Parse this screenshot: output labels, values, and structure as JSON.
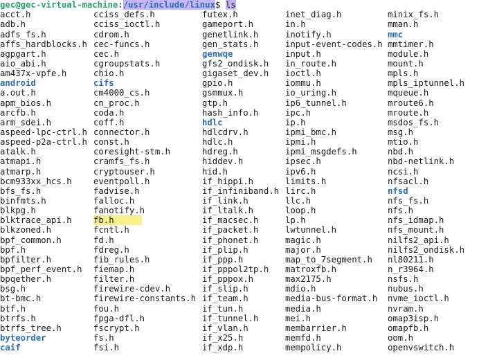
{
  "prompt": {
    "user_host": "gec@gec-virtual-machine",
    "separator": ":",
    "path": "/usr/include/linux",
    "dollar": "$ ",
    "command": "ls"
  },
  "colors": {
    "user": "#26a269",
    "directory": "#2a6fb7",
    "selection": "#c7b6f7",
    "highlight": "#f6f08a"
  },
  "columns": [
    [
      {
        "name": "acct.h"
      },
      {
        "name": "adb.h"
      },
      {
        "name": "adfs_fs.h"
      },
      {
        "name": "affs_hardblocks.h"
      },
      {
        "name": "agpgart.h"
      },
      {
        "name": "aio_abi.h"
      },
      {
        "name": "am437x-vpfe.h"
      },
      {
        "name": "android",
        "dir": true
      },
      {
        "name": "a.out.h"
      },
      {
        "name": "apm_bios.h"
      },
      {
        "name": "arcfb.h"
      },
      {
        "name": "arm_sdei.h"
      },
      {
        "name": "aspeed-lpc-ctrl.h"
      },
      {
        "name": "aspeed-p2a-ctrl.h"
      },
      {
        "name": "atalk.h"
      },
      {
        "name": "atmapi.h"
      },
      {
        "name": "atmarp.h"
      },
      {
        "name": "bcm933xx_hcs.h"
      },
      {
        "name": "bfs_fs.h"
      },
      {
        "name": "binfmts.h"
      },
      {
        "name": "blkpg.h"
      },
      {
        "name": "blktrace_api.h"
      },
      {
        "name": "blkzoned.h"
      },
      {
        "name": "bpf_common.h"
      },
      {
        "name": "bpf.h"
      },
      {
        "name": "bpfilter.h"
      },
      {
        "name": "bpf_perf_event.h"
      },
      {
        "name": "bpqether.h"
      },
      {
        "name": "bsg.h"
      },
      {
        "name": "bt-bmc.h"
      },
      {
        "name": "btf.h"
      },
      {
        "name": "btrfs.h"
      },
      {
        "name": "btrfs_tree.h"
      },
      {
        "name": "byteorder",
        "dir": true
      },
      {
        "name": "caif",
        "dir": true
      }
    ],
    [
      {
        "name": "cciss_defs.h"
      },
      {
        "name": "cciss_ioctl.h"
      },
      {
        "name": "cdrom.h"
      },
      {
        "name": "cec-funcs.h"
      },
      {
        "name": "cec.h"
      },
      {
        "name": "cgroupstats.h"
      },
      {
        "name": "chio.h"
      },
      {
        "name": "cifs",
        "dir": true
      },
      {
        "name": "cm4000_cs.h"
      },
      {
        "name": "cn_proc.h"
      },
      {
        "name": "coda.h"
      },
      {
        "name": "coff.h"
      },
      {
        "name": "connector.h"
      },
      {
        "name": "const.h"
      },
      {
        "name": "coresight-stm.h"
      },
      {
        "name": "cramfs_fs.h"
      },
      {
        "name": "cryptouser.h"
      },
      {
        "name": "eventpoll.h"
      },
      {
        "name": "fadvise.h"
      },
      {
        "name": "falloc.h"
      },
      {
        "name": "fanotify.h"
      },
      {
        "name": "fb.h",
        "highlight": true
      },
      {
        "name": "fcntl.h"
      },
      {
        "name": "fd.h"
      },
      {
        "name": "fdreg.h"
      },
      {
        "name": "fib_rules.h"
      },
      {
        "name": "fiemap.h"
      },
      {
        "name": "filter.h"
      },
      {
        "name": "firewire-cdev.h"
      },
      {
        "name": "firewire-constants.h"
      },
      {
        "name": "fou.h"
      },
      {
        "name": "fpga-dfl.h"
      },
      {
        "name": "fscrypt.h"
      },
      {
        "name": "fs.h"
      },
      {
        "name": "fsi.h"
      }
    ],
    [
      {
        "name": "futex.h"
      },
      {
        "name": "gameport.h"
      },
      {
        "name": "genetlink.h"
      },
      {
        "name": "gen_stats.h"
      },
      {
        "name": "genwqe",
        "dir": true
      },
      {
        "name": "gfs2_ondisk.h"
      },
      {
        "name": "gigaset_dev.h"
      },
      {
        "name": "gpio.h"
      },
      {
        "name": "gsmmux.h"
      },
      {
        "name": "gtp.h"
      },
      {
        "name": "hash_info.h"
      },
      {
        "name": "hdlc",
        "dir": true
      },
      {
        "name": "hdlcdrv.h"
      },
      {
        "name": "hdlc.h"
      },
      {
        "name": "hdreg.h"
      },
      {
        "name": "hiddev.h"
      },
      {
        "name": "hid.h"
      },
      {
        "name": "if_hippi.h"
      },
      {
        "name": "if_infiniband.h"
      },
      {
        "name": "if_link.h"
      },
      {
        "name": "if_ltalk.h"
      },
      {
        "name": "if_macsec.h"
      },
      {
        "name": "if_packet.h"
      },
      {
        "name": "if_phonet.h"
      },
      {
        "name": "if_plip.h"
      },
      {
        "name": "if_ppp.h"
      },
      {
        "name": "if_pppol2tp.h"
      },
      {
        "name": "if_pppox.h"
      },
      {
        "name": "if_slip.h"
      },
      {
        "name": "if_team.h"
      },
      {
        "name": "if_tun.h"
      },
      {
        "name": "if_tunnel.h"
      },
      {
        "name": "if_vlan.h"
      },
      {
        "name": "if_x25.h"
      },
      {
        "name": "if_xdp.h"
      }
    ],
    [
      {
        "name": "inet_diag.h"
      },
      {
        "name": "in.h"
      },
      {
        "name": "inotify.h"
      },
      {
        "name": "input-event-codes.h"
      },
      {
        "name": "input.h"
      },
      {
        "name": "in_route.h"
      },
      {
        "name": "ioctl.h"
      },
      {
        "name": "iommu.h"
      },
      {
        "name": "io_uring.h"
      },
      {
        "name": "ip6_tunnel.h"
      },
      {
        "name": "ipc.h"
      },
      {
        "name": "ip.h"
      },
      {
        "name": "ipmi_bmc.h"
      },
      {
        "name": "ipmi.h"
      },
      {
        "name": "ipmi_msgdefs.h"
      },
      {
        "name": "ipsec.h"
      },
      {
        "name": "ipv6.h"
      },
      {
        "name": "limits.h"
      },
      {
        "name": "lirc.h"
      },
      {
        "name": "llc.h"
      },
      {
        "name": "loop.h"
      },
      {
        "name": "lp.h"
      },
      {
        "name": "lwtunnel.h"
      },
      {
        "name": "magic.h"
      },
      {
        "name": "major.h"
      },
      {
        "name": "map_to_7segment.h"
      },
      {
        "name": "matroxfb.h"
      },
      {
        "name": "max2175.h"
      },
      {
        "name": "mdio.h"
      },
      {
        "name": "media-bus-format.h"
      },
      {
        "name": "media.h"
      },
      {
        "name": "mei.h"
      },
      {
        "name": "membarrier.h"
      },
      {
        "name": "memfd.h"
      },
      {
        "name": "mempolicy.h"
      }
    ],
    [
      {
        "name": "minix_fs.h"
      },
      {
        "name": "mman.h"
      },
      {
        "name": "mmc",
        "dir": true
      },
      {
        "name": "mmtimer.h"
      },
      {
        "name": "module.h"
      },
      {
        "name": "mount.h"
      },
      {
        "name": "mpls.h"
      },
      {
        "name": "mpls_iptunnel.h"
      },
      {
        "name": "mqueue.h"
      },
      {
        "name": "mroute6.h"
      },
      {
        "name": "mroute.h"
      },
      {
        "name": "msdos_fs.h"
      },
      {
        "name": "msg.h"
      },
      {
        "name": "mtio.h"
      },
      {
        "name": "nbd.h"
      },
      {
        "name": "nbd-netlink.h"
      },
      {
        "name": "ncsi.h"
      },
      {
        "name": "nfsacl.h"
      },
      {
        "name": "nfsd",
        "dir": true
      },
      {
        "name": "nfs_fs.h"
      },
      {
        "name": "nfs.h"
      },
      {
        "name": "nfs_idmap.h"
      },
      {
        "name": "nfs_mount.h"
      },
      {
        "name": "nilfs2_api.h"
      },
      {
        "name": "nilfs2_ondisk.h"
      },
      {
        "name": "nl80211.h"
      },
      {
        "name": "n_r3964.h"
      },
      {
        "name": "nsfs.h"
      },
      {
        "name": "nubus.h"
      },
      {
        "name": "nvme_ioctl.h"
      },
      {
        "name": "nvram.h"
      },
      {
        "name": "omap3isp.h"
      },
      {
        "name": "omapfb.h"
      },
      {
        "name": "oom.h"
      },
      {
        "name": "openvswitch.h"
      }
    ]
  ]
}
